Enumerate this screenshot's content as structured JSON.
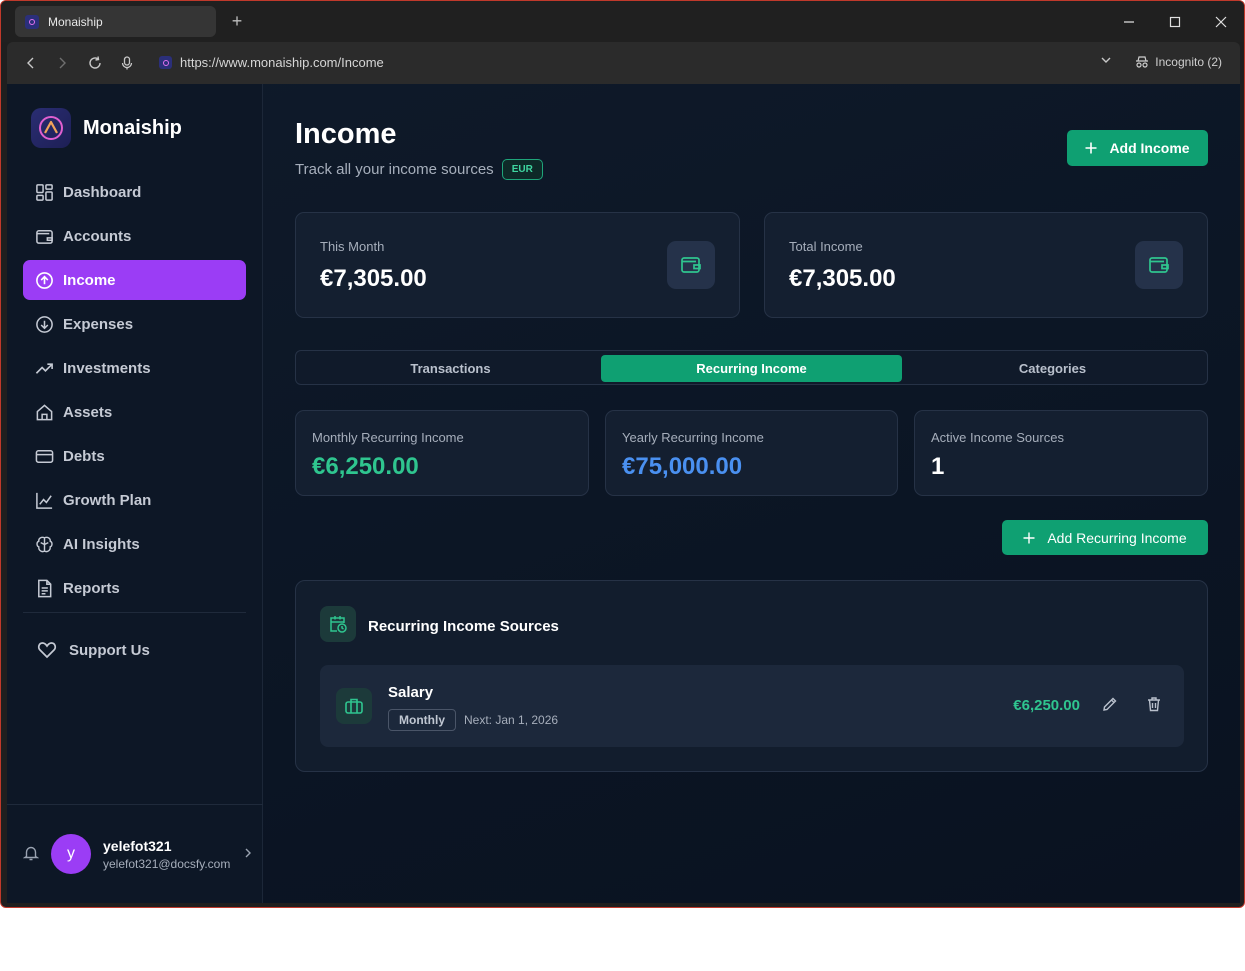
{
  "browser": {
    "tab_title": "Monaiship",
    "new_tab_symbol": "+",
    "url": "https://www.monaiship.com/Income",
    "incognito_label": "Incognito (2)"
  },
  "sidebar": {
    "brand": "Monaiship",
    "items": [
      {
        "label": "Dashboard",
        "icon": "dashboard-icon"
      },
      {
        "label": "Accounts",
        "icon": "wallet-icon"
      },
      {
        "label": "Income",
        "icon": "arrow-up-circle-icon",
        "active": true
      },
      {
        "label": "Expenses",
        "icon": "arrow-down-circle-icon"
      },
      {
        "label": "Investments",
        "icon": "trending-up-icon"
      },
      {
        "label": "Assets",
        "icon": "home-icon"
      },
      {
        "label": "Debts",
        "icon": "credit-card-icon"
      },
      {
        "label": "Growth Plan",
        "icon": "line-chart-icon"
      },
      {
        "label": "AI Insights",
        "icon": "brain-icon"
      },
      {
        "label": "Reports",
        "icon": "document-icon"
      }
    ],
    "support_label": "Support Us",
    "user": {
      "initial": "y",
      "name": "yelefot321",
      "email": "yelefot321@docsfy.com"
    }
  },
  "header": {
    "title": "Income",
    "subtitle": "Track all your income sources",
    "currency": "EUR",
    "add_button": "Add Income"
  },
  "summary": {
    "this_month_label": "This Month",
    "this_month_value": "€7,305.00",
    "total_label": "Total Income",
    "total_value": "€7,305.00"
  },
  "tabs": [
    {
      "label": "Transactions"
    },
    {
      "label": "Recurring Income",
      "active": true
    },
    {
      "label": "Categories"
    }
  ],
  "recurring_stats": {
    "monthly_label": "Monthly Recurring Income",
    "monthly_value": "€6,250.00",
    "yearly_label": "Yearly Recurring Income",
    "yearly_value": "€75,000.00",
    "active_label": "Active Income Sources",
    "active_value": "1"
  },
  "add_recurring_button": "Add Recurring Income",
  "sources": {
    "title": "Recurring Income Sources",
    "items": [
      {
        "name": "Salary",
        "frequency": "Monthly",
        "next": "Next: Jan 1, 2026",
        "amount": "€6,250.00"
      }
    ]
  },
  "colors": {
    "accent_purple": "#9b3df5",
    "accent_green": "#0fa072",
    "value_green": "#2fc58f",
    "value_blue": "#4a90f0"
  }
}
